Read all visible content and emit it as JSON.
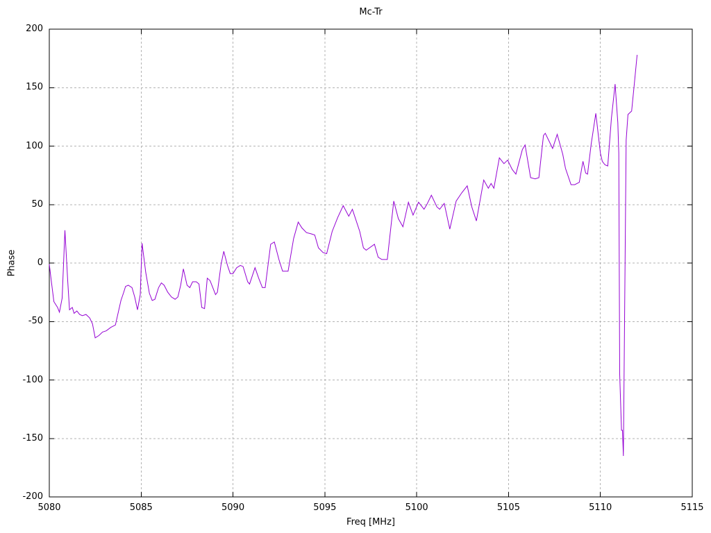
{
  "title": "Mc-Tr",
  "colors": {
    "line": "#9400D3",
    "grid": "#b3b3b3",
    "border": "#000000",
    "background": "#ffffff",
    "text": "#000000"
  },
  "chart_data": {
    "type": "line",
    "title": "Mc-Tr",
    "xlabel": "Freq [MHz]",
    "ylabel": "Phase",
    "xlim": [
      5080,
      5115
    ],
    "ylim": [
      -200,
      200
    ],
    "x_ticks": [
      5080,
      5085,
      5090,
      5095,
      5100,
      5105,
      5110,
      5115
    ],
    "y_ticks": [
      -200,
      -150,
      -100,
      -50,
      0,
      50,
      100,
      150,
      200
    ],
    "grid": true,
    "grid_style": "dashed",
    "legend": false,
    "series": [
      {
        "name": "Mc-Tr",
        "color": "#9400D3",
        "points": [
          [
            5080.0,
            -1
          ],
          [
            5080.1,
            -14
          ],
          [
            5080.25,
            -33
          ],
          [
            5080.45,
            -38
          ],
          [
            5080.55,
            -42
          ],
          [
            5080.7,
            -30
          ],
          [
            5080.85,
            28
          ],
          [
            5081.0,
            -15
          ],
          [
            5081.1,
            -40
          ],
          [
            5081.25,
            -38
          ],
          [
            5081.35,
            -43
          ],
          [
            5081.5,
            -41
          ],
          [
            5081.65,
            -44
          ],
          [
            5081.8,
            -45
          ],
          [
            5082.0,
            -44
          ],
          [
            5082.2,
            -47
          ],
          [
            5082.35,
            -52
          ],
          [
            5082.5,
            -64
          ],
          [
            5082.7,
            -62
          ],
          [
            5082.9,
            -59
          ],
          [
            5083.1,
            -58
          ],
          [
            5083.35,
            -55
          ],
          [
            5083.6,
            -53
          ],
          [
            5083.9,
            -32
          ],
          [
            5084.05,
            -25
          ],
          [
            5084.15,
            -20
          ],
          [
            5084.3,
            -19
          ],
          [
            5084.5,
            -21
          ],
          [
            5084.65,
            -29
          ],
          [
            5084.8,
            -40
          ],
          [
            5084.95,
            -27
          ],
          [
            5085.05,
            17
          ],
          [
            5085.25,
            -8
          ],
          [
            5085.45,
            -26
          ],
          [
            5085.6,
            -32
          ],
          [
            5085.75,
            -31
          ],
          [
            5085.95,
            -21
          ],
          [
            5086.1,
            -17
          ],
          [
            5086.25,
            -19
          ],
          [
            5086.45,
            -25
          ],
          [
            5086.65,
            -29
          ],
          [
            5086.85,
            -31
          ],
          [
            5087.0,
            -29
          ],
          [
            5087.15,
            -19
          ],
          [
            5087.3,
            -5
          ],
          [
            5087.5,
            -19
          ],
          [
            5087.65,
            -21
          ],
          [
            5087.8,
            -16
          ],
          [
            5088.0,
            -16
          ],
          [
            5088.15,
            -18
          ],
          [
            5088.3,
            -38
          ],
          [
            5088.45,
            -39
          ],
          [
            5088.6,
            -13
          ],
          [
            5088.75,
            -15
          ],
          [
            5088.9,
            -21
          ],
          [
            5089.05,
            -27
          ],
          [
            5089.15,
            -25
          ],
          [
            5089.35,
            -1
          ],
          [
            5089.5,
            10
          ],
          [
            5089.7,
            -2
          ],
          [
            5089.85,
            -9
          ],
          [
            5090.0,
            -9
          ],
          [
            5090.2,
            -4
          ],
          [
            5090.4,
            -2
          ],
          [
            5090.55,
            -3
          ],
          [
            5090.8,
            -16
          ],
          [
            5090.9,
            -18
          ],
          [
            5091.2,
            -4
          ],
          [
            5091.4,
            -13
          ],
          [
            5091.6,
            -21
          ],
          [
            5091.75,
            -21
          ],
          [
            5092.05,
            16
          ],
          [
            5092.25,
            18
          ],
          [
            5092.5,
            3
          ],
          [
            5092.7,
            -7
          ],
          [
            5093.0,
            -7
          ],
          [
            5093.3,
            21
          ],
          [
            5093.55,
            35
          ],
          [
            5093.75,
            30
          ],
          [
            5094.0,
            26
          ],
          [
            5094.25,
            25
          ],
          [
            5094.45,
            24
          ],
          [
            5094.65,
            13
          ],
          [
            5094.9,
            9
          ],
          [
            5095.1,
            8
          ],
          [
            5095.4,
            27
          ],
          [
            5095.7,
            39
          ],
          [
            5096.0,
            49
          ],
          [
            5096.3,
            40
          ],
          [
            5096.5,
            46
          ],
          [
            5096.9,
            27
          ],
          [
            5097.1,
            13
          ],
          [
            5097.25,
            11
          ],
          [
            5097.7,
            16
          ],
          [
            5097.9,
            5
          ],
          [
            5098.1,
            3
          ],
          [
            5098.4,
            3
          ],
          [
            5098.75,
            53
          ],
          [
            5099.0,
            38
          ],
          [
            5099.25,
            31
          ],
          [
            5099.55,
            52
          ],
          [
            5099.8,
            41
          ],
          [
            5100.1,
            52
          ],
          [
            5100.4,
            46
          ],
          [
            5100.55,
            50
          ],
          [
            5100.8,
            58
          ],
          [
            5101.1,
            48
          ],
          [
            5101.25,
            46
          ],
          [
            5101.5,
            51
          ],
          [
            5101.8,
            29
          ],
          [
            5102.15,
            53
          ],
          [
            5102.45,
            60
          ],
          [
            5102.75,
            66
          ],
          [
            5103.0,
            48
          ],
          [
            5103.25,
            36
          ],
          [
            5103.65,
            71
          ],
          [
            5103.9,
            64
          ],
          [
            5104.05,
            68
          ],
          [
            5104.2,
            64
          ],
          [
            5104.5,
            90
          ],
          [
            5104.75,
            85
          ],
          [
            5104.95,
            88
          ],
          [
            5105.2,
            80
          ],
          [
            5105.4,
            76
          ],
          [
            5105.75,
            97
          ],
          [
            5105.9,
            101
          ],
          [
            5106.2,
            73
          ],
          [
            5106.45,
            72
          ],
          [
            5106.65,
            73
          ],
          [
            5106.9,
            109
          ],
          [
            5107.0,
            111
          ],
          [
            5107.4,
            98
          ],
          [
            5107.65,
            110
          ],
          [
            5107.95,
            93
          ],
          [
            5108.1,
            81
          ],
          [
            5108.4,
            67
          ],
          [
            5108.6,
            67
          ],
          [
            5108.85,
            69
          ],
          [
            5109.05,
            87
          ],
          [
            5109.2,
            77
          ],
          [
            5109.3,
            76
          ],
          [
            5109.5,
            102
          ],
          [
            5109.75,
            128
          ],
          [
            5110.0,
            94
          ],
          [
            5110.1,
            87
          ],
          [
            5110.25,
            84
          ],
          [
            5110.4,
            83
          ],
          [
            5110.6,
            124
          ],
          [
            5110.8,
            153
          ],
          [
            5110.95,
            120
          ],
          [
            5111.0,
            94
          ],
          [
            5111.05,
            -95
          ],
          [
            5111.15,
            -143
          ],
          [
            5111.2,
            -143
          ],
          [
            5111.25,
            -165
          ],
          [
            5111.4,
            105
          ],
          [
            5111.5,
            127
          ],
          [
            5111.7,
            130
          ],
          [
            5111.85,
            154
          ],
          [
            5112.0,
            178
          ]
        ]
      }
    ]
  }
}
